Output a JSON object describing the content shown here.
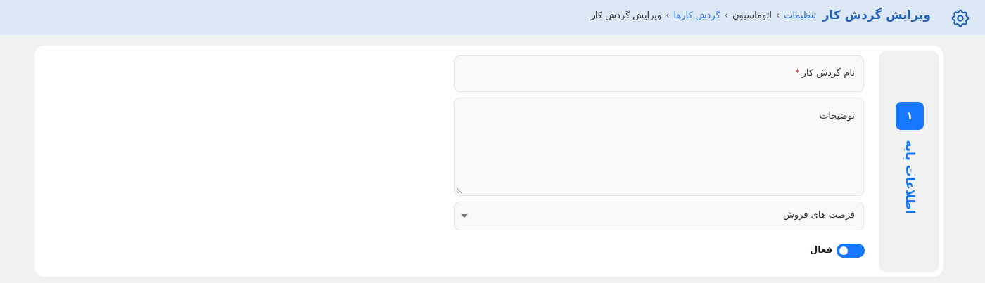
{
  "header": {
    "icon": "gear-icon",
    "title": "ویرایش گردش کار",
    "breadcrumb": [
      {
        "label": "تنظیمات",
        "link": true
      },
      {
        "label": "اتوماسیون",
        "link": false
      },
      {
        "label": "گردش کارها",
        "link": true
      },
      {
        "label": "ویرایش گردش کار",
        "link": false
      }
    ]
  },
  "stepper": {
    "step_number": "۱",
    "step_label": "اطلاعات پایه"
  },
  "form": {
    "name_label": "نام گردش کار",
    "required_mark": "*",
    "description_label": "توضیحات",
    "select_value": "فرصت های فروش",
    "active_label": "فعال",
    "active_on": true
  },
  "colors": {
    "accent": "#1677ff",
    "header_bg": "#dde8f7",
    "title": "#1f5fb8",
    "required": "#e53935"
  }
}
